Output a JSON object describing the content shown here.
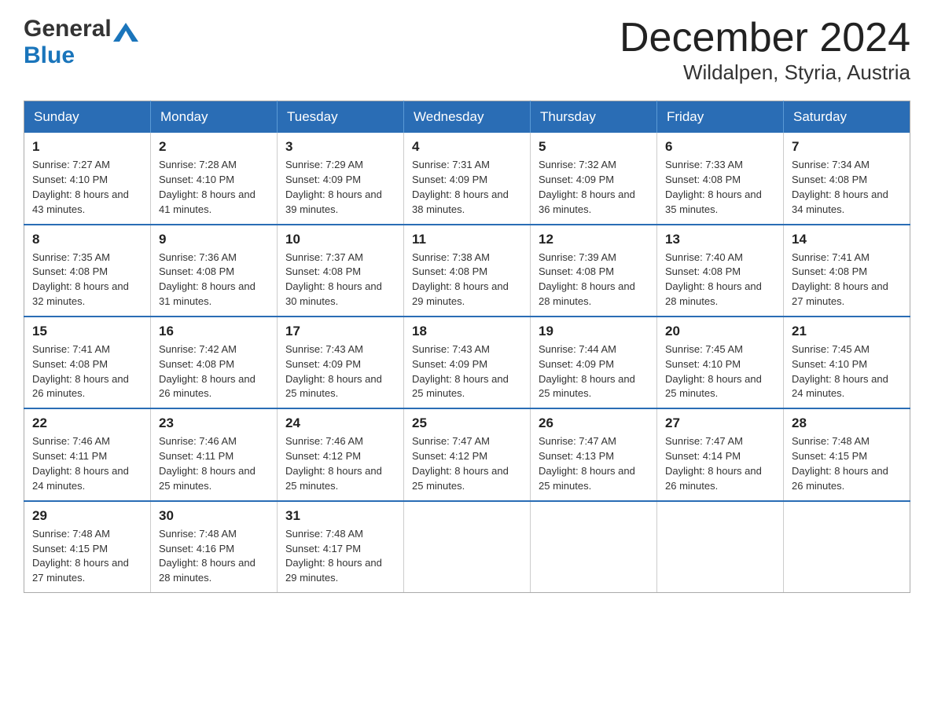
{
  "header": {
    "logo": {
      "general": "General",
      "blue": "Blue"
    },
    "title": "December 2024",
    "subtitle": "Wildalpen, Styria, Austria"
  },
  "weekdays": [
    "Sunday",
    "Monday",
    "Tuesday",
    "Wednesday",
    "Thursday",
    "Friday",
    "Saturday"
  ],
  "weeks": [
    [
      {
        "day": "1",
        "sunrise": "Sunrise: 7:27 AM",
        "sunset": "Sunset: 4:10 PM",
        "daylight": "Daylight: 8 hours and 43 minutes."
      },
      {
        "day": "2",
        "sunrise": "Sunrise: 7:28 AM",
        "sunset": "Sunset: 4:10 PM",
        "daylight": "Daylight: 8 hours and 41 minutes."
      },
      {
        "day": "3",
        "sunrise": "Sunrise: 7:29 AM",
        "sunset": "Sunset: 4:09 PM",
        "daylight": "Daylight: 8 hours and 39 minutes."
      },
      {
        "day": "4",
        "sunrise": "Sunrise: 7:31 AM",
        "sunset": "Sunset: 4:09 PM",
        "daylight": "Daylight: 8 hours and 38 minutes."
      },
      {
        "day": "5",
        "sunrise": "Sunrise: 7:32 AM",
        "sunset": "Sunset: 4:09 PM",
        "daylight": "Daylight: 8 hours and 36 minutes."
      },
      {
        "day": "6",
        "sunrise": "Sunrise: 7:33 AM",
        "sunset": "Sunset: 4:08 PM",
        "daylight": "Daylight: 8 hours and 35 minutes."
      },
      {
        "day": "7",
        "sunrise": "Sunrise: 7:34 AM",
        "sunset": "Sunset: 4:08 PM",
        "daylight": "Daylight: 8 hours and 34 minutes."
      }
    ],
    [
      {
        "day": "8",
        "sunrise": "Sunrise: 7:35 AM",
        "sunset": "Sunset: 4:08 PM",
        "daylight": "Daylight: 8 hours and 32 minutes."
      },
      {
        "day": "9",
        "sunrise": "Sunrise: 7:36 AM",
        "sunset": "Sunset: 4:08 PM",
        "daylight": "Daylight: 8 hours and 31 minutes."
      },
      {
        "day": "10",
        "sunrise": "Sunrise: 7:37 AM",
        "sunset": "Sunset: 4:08 PM",
        "daylight": "Daylight: 8 hours and 30 minutes."
      },
      {
        "day": "11",
        "sunrise": "Sunrise: 7:38 AM",
        "sunset": "Sunset: 4:08 PM",
        "daylight": "Daylight: 8 hours and 29 minutes."
      },
      {
        "day": "12",
        "sunrise": "Sunrise: 7:39 AM",
        "sunset": "Sunset: 4:08 PM",
        "daylight": "Daylight: 8 hours and 28 minutes."
      },
      {
        "day": "13",
        "sunrise": "Sunrise: 7:40 AM",
        "sunset": "Sunset: 4:08 PM",
        "daylight": "Daylight: 8 hours and 28 minutes."
      },
      {
        "day": "14",
        "sunrise": "Sunrise: 7:41 AM",
        "sunset": "Sunset: 4:08 PM",
        "daylight": "Daylight: 8 hours and 27 minutes."
      }
    ],
    [
      {
        "day": "15",
        "sunrise": "Sunrise: 7:41 AM",
        "sunset": "Sunset: 4:08 PM",
        "daylight": "Daylight: 8 hours and 26 minutes."
      },
      {
        "day": "16",
        "sunrise": "Sunrise: 7:42 AM",
        "sunset": "Sunset: 4:08 PM",
        "daylight": "Daylight: 8 hours and 26 minutes."
      },
      {
        "day": "17",
        "sunrise": "Sunrise: 7:43 AM",
        "sunset": "Sunset: 4:09 PM",
        "daylight": "Daylight: 8 hours and 25 minutes."
      },
      {
        "day": "18",
        "sunrise": "Sunrise: 7:43 AM",
        "sunset": "Sunset: 4:09 PM",
        "daylight": "Daylight: 8 hours and 25 minutes."
      },
      {
        "day": "19",
        "sunrise": "Sunrise: 7:44 AM",
        "sunset": "Sunset: 4:09 PM",
        "daylight": "Daylight: 8 hours and 25 minutes."
      },
      {
        "day": "20",
        "sunrise": "Sunrise: 7:45 AM",
        "sunset": "Sunset: 4:10 PM",
        "daylight": "Daylight: 8 hours and 25 minutes."
      },
      {
        "day": "21",
        "sunrise": "Sunrise: 7:45 AM",
        "sunset": "Sunset: 4:10 PM",
        "daylight": "Daylight: 8 hours and 24 minutes."
      }
    ],
    [
      {
        "day": "22",
        "sunrise": "Sunrise: 7:46 AM",
        "sunset": "Sunset: 4:11 PM",
        "daylight": "Daylight: 8 hours and 24 minutes."
      },
      {
        "day": "23",
        "sunrise": "Sunrise: 7:46 AM",
        "sunset": "Sunset: 4:11 PM",
        "daylight": "Daylight: 8 hours and 25 minutes."
      },
      {
        "day": "24",
        "sunrise": "Sunrise: 7:46 AM",
        "sunset": "Sunset: 4:12 PM",
        "daylight": "Daylight: 8 hours and 25 minutes."
      },
      {
        "day": "25",
        "sunrise": "Sunrise: 7:47 AM",
        "sunset": "Sunset: 4:12 PM",
        "daylight": "Daylight: 8 hours and 25 minutes."
      },
      {
        "day": "26",
        "sunrise": "Sunrise: 7:47 AM",
        "sunset": "Sunset: 4:13 PM",
        "daylight": "Daylight: 8 hours and 25 minutes."
      },
      {
        "day": "27",
        "sunrise": "Sunrise: 7:47 AM",
        "sunset": "Sunset: 4:14 PM",
        "daylight": "Daylight: 8 hours and 26 minutes."
      },
      {
        "day": "28",
        "sunrise": "Sunrise: 7:48 AM",
        "sunset": "Sunset: 4:15 PM",
        "daylight": "Daylight: 8 hours and 26 minutes."
      }
    ],
    [
      {
        "day": "29",
        "sunrise": "Sunrise: 7:48 AM",
        "sunset": "Sunset: 4:15 PM",
        "daylight": "Daylight: 8 hours and 27 minutes."
      },
      {
        "day": "30",
        "sunrise": "Sunrise: 7:48 AM",
        "sunset": "Sunset: 4:16 PM",
        "daylight": "Daylight: 8 hours and 28 minutes."
      },
      {
        "day": "31",
        "sunrise": "Sunrise: 7:48 AM",
        "sunset": "Sunset: 4:17 PM",
        "daylight": "Daylight: 8 hours and 29 minutes."
      },
      null,
      null,
      null,
      null
    ]
  ]
}
